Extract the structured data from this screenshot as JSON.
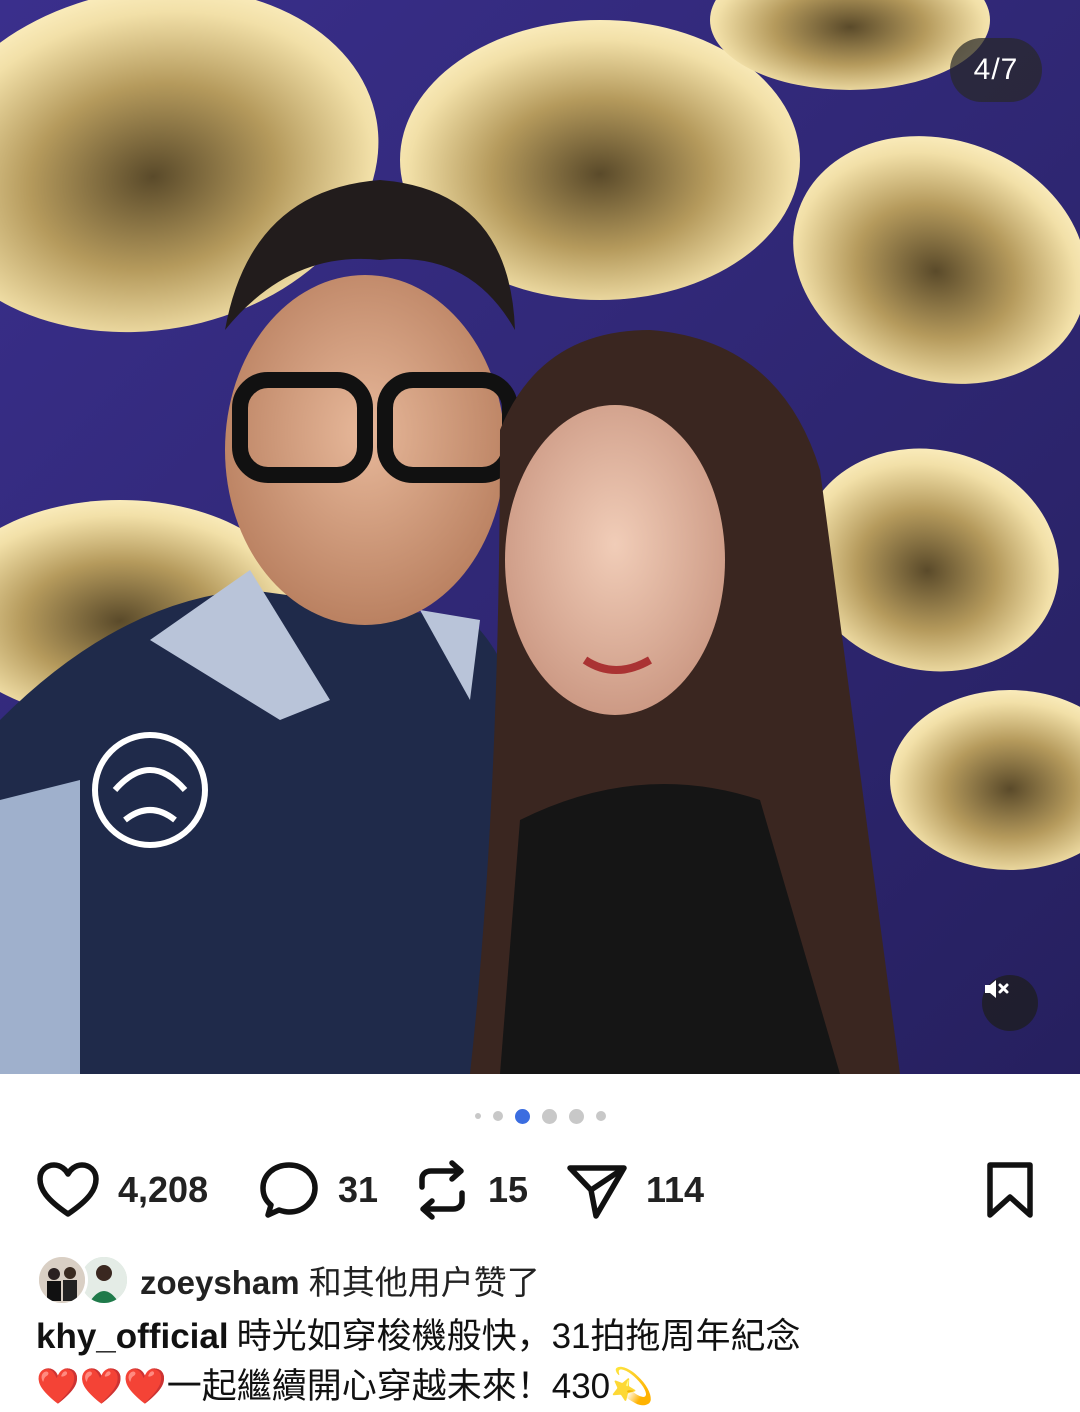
{
  "carousel": {
    "counter": "4/7",
    "dots": [
      {
        "size": "small",
        "active": false
      },
      {
        "size": "medium",
        "active": false
      },
      {
        "size": "large",
        "active": true
      },
      {
        "size": "large",
        "active": false
      },
      {
        "size": "large",
        "active": false
      },
      {
        "size": "medium",
        "active": false
      }
    ]
  },
  "actions": {
    "likes": "4,208",
    "comments": "31",
    "reposts": "15",
    "shares": "114"
  },
  "liked_by": {
    "username": "zoeysham",
    "suffix": " 和其他用户赞了"
  },
  "caption": {
    "username": "khy_official",
    "line1": "時光如穿梭機般快，31拍拖周年紀念",
    "line2": "❤️❤️❤️一起繼續開心穿越未來！430💫"
  },
  "colors": {
    "dot_active": "#3b6de0",
    "dot_inactive": "#c8c8c8",
    "photo_bg": "#3b2f8f"
  }
}
